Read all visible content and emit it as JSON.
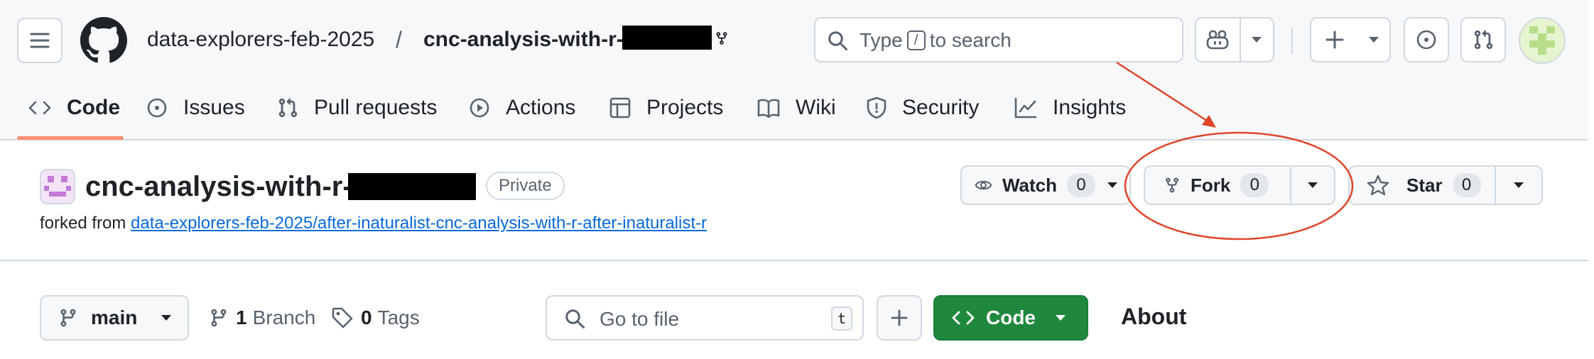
{
  "header": {
    "org": "data-explorers-feb-2025",
    "separator": "/",
    "repo": "cnc-analysis-with-r-",
    "search": {
      "prefix": "Type",
      "key": "/",
      "suffix": "to search"
    }
  },
  "tabs": [
    {
      "label": "Code"
    },
    {
      "label": "Issues"
    },
    {
      "label": "Pull requests"
    },
    {
      "label": "Actions"
    },
    {
      "label": "Projects"
    },
    {
      "label": "Wiki"
    },
    {
      "label": "Security"
    },
    {
      "label": "Insights"
    }
  ],
  "repo_header": {
    "title": "cnc-analysis-with-r-",
    "badge": "Private",
    "forked_prefix": "forked from",
    "forked_link": "data-explorers-feb-2025/after-inaturalist-cnc-analysis-with-r-after-inaturalist-r",
    "watch": {
      "label": "Watch",
      "count": "0"
    },
    "fork": {
      "label": "Fork",
      "count": "0"
    },
    "star": {
      "label": "Star",
      "count": "0"
    }
  },
  "toolbar": {
    "branch": "main",
    "branches": {
      "count": "1",
      "label": "Branch"
    },
    "tags": {
      "count": "0",
      "label": "Tags"
    },
    "goto_placeholder": "Go to file",
    "goto_key": "t",
    "code_button": "Code",
    "about": "About"
  },
  "colors": {
    "accent_tab": "#fd8c73",
    "code_button": "#1f883d",
    "link": "#0969da",
    "annotation": "#e0452b"
  }
}
